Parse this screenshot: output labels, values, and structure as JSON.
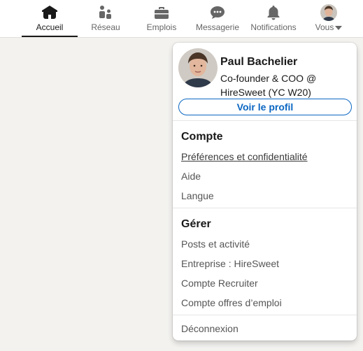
{
  "nav": {
    "items": [
      {
        "label": "Accueil",
        "icon": "home-icon",
        "active": true
      },
      {
        "label": "Réseau",
        "icon": "network-icon"
      },
      {
        "label": "Emplois",
        "icon": "briefcase-icon"
      },
      {
        "label": "Messagerie",
        "icon": "message-icon"
      },
      {
        "label": "Notifications",
        "icon": "bell-icon"
      },
      {
        "label": "Vous",
        "icon": "avatar"
      }
    ]
  },
  "profile": {
    "name": "Paul Bachelier",
    "headline": "Co-founder & COO @ HireSweet (YC W20)",
    "view_profile_label": "Voir le profil"
  },
  "sections": {
    "account": {
      "title": "Compte",
      "items": [
        "Préférences et confidentialité",
        "Aide",
        "Langue"
      ]
    },
    "manage": {
      "title": "Gérer",
      "items": [
        "Posts et activité",
        "Entreprise : HireSweet",
        "Compte Recruiter",
        "Compte offres d’emploi"
      ]
    }
  },
  "signout_label": "Déconnexion",
  "colors": {
    "accent": "#0a66c2",
    "text": "#191919",
    "muted": "#666666",
    "background": "#f3f2ef"
  }
}
